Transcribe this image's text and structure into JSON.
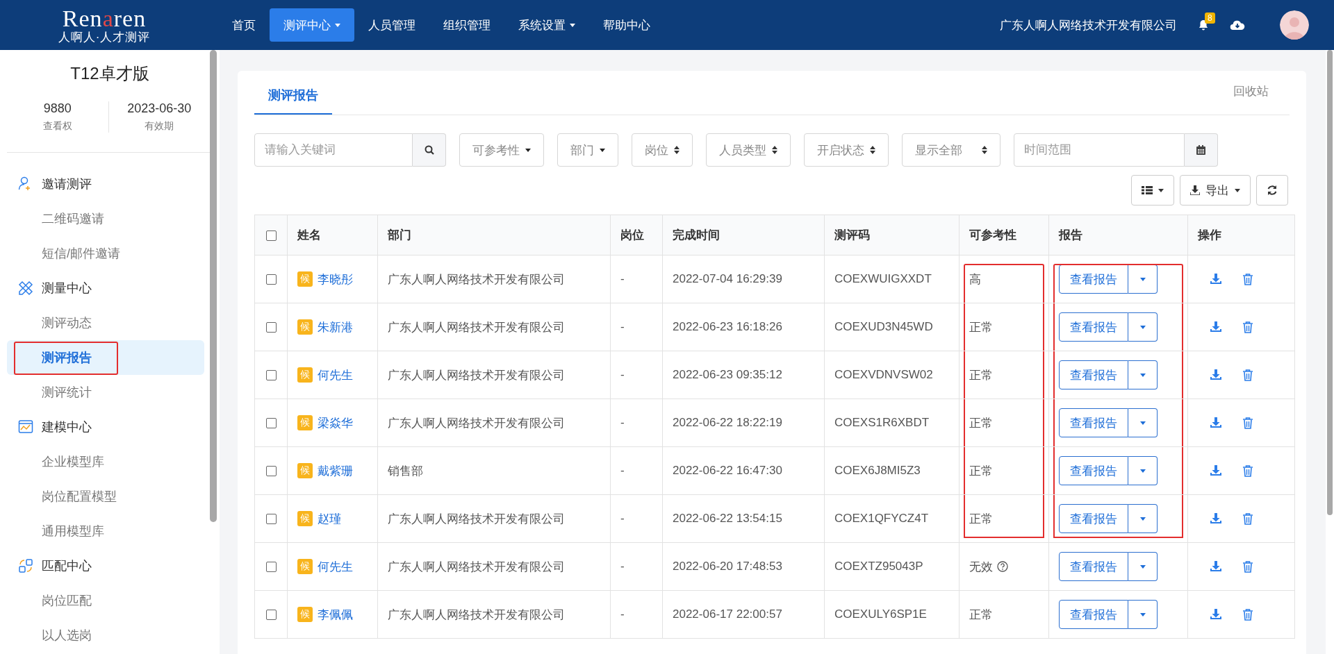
{
  "header": {
    "logo_parts": [
      {
        "text": "Ren",
        "accent": false
      },
      {
        "text": "a",
        "accent": true
      },
      {
        "text": "ren",
        "accent": false
      }
    ],
    "logo_subtitle": "人啊人·人才测评",
    "nav": [
      {
        "label": "首页",
        "selected": false,
        "dropdown": false
      },
      {
        "label": "测评中心",
        "selected": true,
        "dropdown": true
      },
      {
        "label": "人员管理",
        "selected": false,
        "dropdown": false
      },
      {
        "label": "组织管理",
        "selected": false,
        "dropdown": false
      },
      {
        "label": "系统设置",
        "selected": false,
        "dropdown": true
      },
      {
        "label": "帮助中心",
        "selected": false,
        "dropdown": false
      }
    ],
    "company": "广东人啊人网络技术开发有限公司",
    "notification_count": "8"
  },
  "sidebar": {
    "edition": "T12卓才版",
    "stats": [
      {
        "value": "9880",
        "label": "查看权"
      },
      {
        "value": "2023-06-30",
        "label": "有效期"
      }
    ],
    "groups": [
      {
        "title": "邀请测评",
        "items": [
          {
            "label": "二维码邀请",
            "selected": false,
            "annotated": false
          },
          {
            "label": "短信/邮件邀请",
            "selected": false,
            "annotated": false
          }
        ]
      },
      {
        "title": "测量中心",
        "items": [
          {
            "label": "测评动态",
            "selected": false,
            "annotated": false
          },
          {
            "label": "测评报告",
            "selected": true,
            "annotated": true
          },
          {
            "label": "测评统计",
            "selected": false,
            "annotated": false
          }
        ]
      },
      {
        "title": "建模中心",
        "items": [
          {
            "label": "企业模型库",
            "selected": false,
            "annotated": false
          },
          {
            "label": "岗位配置模型",
            "selected": false,
            "annotated": false
          },
          {
            "label": "通用模型库",
            "selected": false,
            "annotated": false
          }
        ]
      },
      {
        "title": "匹配中心",
        "items": [
          {
            "label": "岗位匹配",
            "selected": false,
            "annotated": false
          },
          {
            "label": "以人选岗",
            "selected": false,
            "annotated": false
          }
        ]
      }
    ]
  },
  "content": {
    "tabs": [
      {
        "label": "测评报告",
        "selected": true
      }
    ],
    "recycle_bin": "回收站",
    "filters": [
      {
        "kind": "search",
        "placeholder": "请输入关键词"
      },
      {
        "kind": "dropdown",
        "label": "可参考性"
      },
      {
        "kind": "dropdown",
        "label": "部门"
      },
      {
        "kind": "sort",
        "label": "岗位"
      },
      {
        "kind": "sort",
        "label": "人员类型"
      },
      {
        "kind": "sort",
        "label": "开启状态"
      },
      {
        "kind": "sort",
        "label": "显示全部"
      },
      {
        "kind": "date",
        "placeholder": "时间范围"
      }
    ],
    "toolbar": [
      {
        "kind": "columns"
      },
      {
        "kind": "export",
        "label": "导出"
      },
      {
        "kind": "refresh"
      }
    ],
    "table": {
      "select_all_checked": false,
      "columns": [
        "姓名",
        "部门",
        "岗位",
        "完成时间",
        "测评码",
        "可参考性",
        "报告",
        "操作"
      ],
      "rows": [
        {
          "checked": false,
          "tag": "候",
          "name": "李晓彤",
          "department": "广东人啊人网络技术开发有限公司",
          "position": "-",
          "completed": "2022-07-04 16:29:39",
          "code": "COEXWUIGXXDT",
          "reference": "高",
          "reference_help": false,
          "report": "查看报告",
          "annotated": true
        },
        {
          "checked": false,
          "tag": "候",
          "name": "朱新港",
          "department": "广东人啊人网络技术开发有限公司",
          "position": "-",
          "completed": "2022-06-23 16:18:26",
          "code": "COEXUD3N45WD",
          "reference": "正常",
          "reference_help": false,
          "report": "查看报告",
          "annotated": true
        },
        {
          "checked": false,
          "tag": "候",
          "name": "何先生",
          "department": "广东人啊人网络技术开发有限公司",
          "position": "-",
          "completed": "2022-06-23 09:35:12",
          "code": "COEXVDNVSW02",
          "reference": "正常",
          "reference_help": false,
          "report": "查看报告",
          "annotated": true
        },
        {
          "checked": false,
          "tag": "候",
          "name": "梁焱华",
          "department": "广东人啊人网络技术开发有限公司",
          "position": "-",
          "completed": "2022-06-22 18:22:19",
          "code": "COEXS1R6XBDT",
          "reference": "正常",
          "reference_help": false,
          "report": "查看报告",
          "annotated": true
        },
        {
          "checked": false,
          "tag": "候",
          "name": "戴紫珊",
          "department": "销售部",
          "position": "-",
          "completed": "2022-06-22 16:47:30",
          "code": "COEX6J8MI5Z3",
          "reference": "正常",
          "reference_help": false,
          "report": "查看报告",
          "annotated": true
        },
        {
          "checked": false,
          "tag": "候",
          "name": "赵瑾",
          "department": "广东人啊人网络技术开发有限公司",
          "position": "-",
          "completed": "2022-06-22 13:54:15",
          "code": "COEX1QFYCZ4T",
          "reference": "正常",
          "reference_help": false,
          "report": "查看报告",
          "annotated": true
        },
        {
          "checked": false,
          "tag": "候",
          "name": "何先生",
          "department": "广东人啊人网络技术开发有限公司",
          "position": "-",
          "completed": "2022-06-20 17:48:53",
          "code": "COEXTZ95043P",
          "reference": "无效",
          "reference_help": true,
          "report": "查看报告",
          "annotated": false
        },
        {
          "checked": false,
          "tag": "候",
          "name": "李佩佩",
          "department": "广东人啊人网络技术开发有限公司",
          "position": "-",
          "completed": "2022-06-17 22:00:57",
          "code": "COEXULY6SP1E",
          "reference": "正常",
          "reference_help": false,
          "report": "查看报告",
          "annotated": false
        }
      ]
    }
  }
}
